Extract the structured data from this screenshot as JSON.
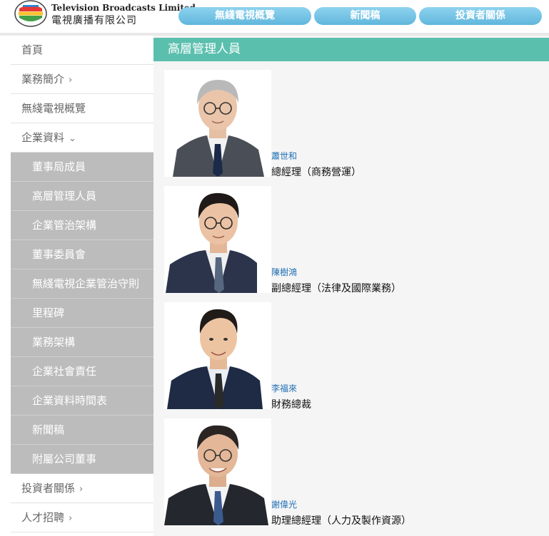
{
  "brand": {
    "name_en": "Television Broadcasts Limited",
    "name_zh": "電視廣播有限公司"
  },
  "topnav": [
    {
      "label": "無綫電視概覽"
    },
    {
      "label": "新聞稿"
    },
    {
      "label": "投資者關係"
    }
  ],
  "sidebar": {
    "items": [
      {
        "label": "首頁",
        "chevron": ""
      },
      {
        "label": "業務簡介",
        "chevron": "›"
      },
      {
        "label": "無綫電視概覽",
        "chevron": ""
      },
      {
        "label": "企業資料",
        "chevron": "⌄"
      }
    ],
    "subitems": [
      {
        "label": "董事局成員"
      },
      {
        "label": "高層管理人員"
      },
      {
        "label": "企業管治架構"
      },
      {
        "label": "董事委員會"
      },
      {
        "label": "無綫電視企業管治守則"
      },
      {
        "label": "里程碑"
      },
      {
        "label": "業務架構"
      },
      {
        "label": "企業社會責任"
      },
      {
        "label": "企業資料時間表"
      },
      {
        "label": "新聞稿"
      },
      {
        "label": "附屬公司董事"
      }
    ],
    "bottom_items": [
      {
        "label": "投資者關係",
        "chevron": "›"
      },
      {
        "label": "人才招聘",
        "chevron": "›"
      }
    ]
  },
  "main": {
    "title": "高層管理人員",
    "people": [
      {
        "name": "蕭世和",
        "title": "總經理（商務營運）"
      },
      {
        "name": "陳樹鴻",
        "title": "副總經理（法律及國際業務）"
      },
      {
        "name": "李福來",
        "title": "財務總裁"
      },
      {
        "name": "謝偉光",
        "title": "助理總經理（人力及製作資源）"
      }
    ]
  },
  "colors": {
    "accent_teal": "#5bbfae",
    "nav_blue": "#6cc0e4",
    "link_blue": "#1f6fb5",
    "submenu_grey": "#bcbcbc"
  }
}
